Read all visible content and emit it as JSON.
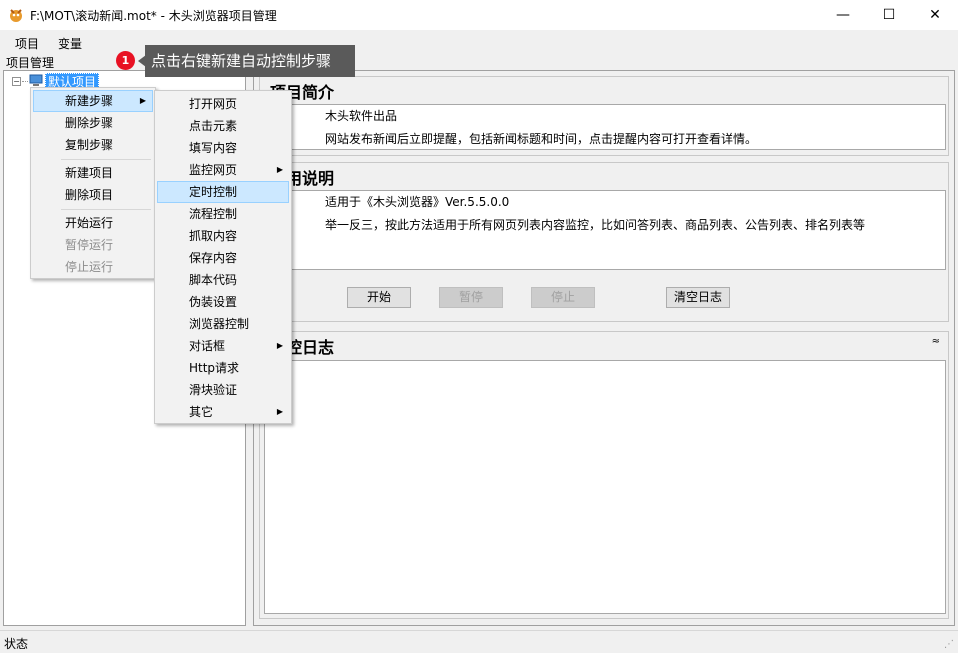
{
  "window": {
    "title": "F:\\MOT\\滚动新闻.mot* - 木头浏览器项目管理",
    "minimize": "—",
    "maximize": "☐",
    "close": "✕"
  },
  "menubar": {
    "items": [
      "项目",
      "变量"
    ]
  },
  "tree": {
    "label": "项目管理",
    "toggle": "−",
    "root_node": "默认项目"
  },
  "context_menu": {
    "items": [
      {
        "label": "新建步骤",
        "submenu": true,
        "highlighted": true
      },
      {
        "label": "删除步骤"
      },
      {
        "label": "复制步骤"
      },
      {
        "label": "新建项目"
      },
      {
        "label": "删除项目"
      },
      {
        "label": "开始运行"
      },
      {
        "label": "暂停运行",
        "disabled": true
      },
      {
        "label": "停止运行",
        "disabled": true
      }
    ]
  },
  "submenu": {
    "items": [
      {
        "label": "打开网页"
      },
      {
        "label": "点击元素"
      },
      {
        "label": "填写内容"
      },
      {
        "label": "监控网页",
        "submenu": true
      },
      {
        "label": "定时控制",
        "highlighted": true
      },
      {
        "label": "流程控制"
      },
      {
        "label": "抓取内容"
      },
      {
        "label": "保存内容"
      },
      {
        "label": "脚本代码"
      },
      {
        "label": "伪装设置"
      },
      {
        "label": "浏览器控制"
      },
      {
        "label": "对话框",
        "submenu": true
      },
      {
        "label": "Http请求"
      },
      {
        "label": "滑块验证"
      },
      {
        "label": "其它",
        "submenu": true
      }
    ],
    "arrow": "▶"
  },
  "tooltip": {
    "badge": "1",
    "text": "点击右键新建自动控制步骤"
  },
  "intro": {
    "title": "项目简介",
    "lines": [
      "木头软件出品",
      "网站发布新闻后立即提醒，包括新闻标题和时间，点击提醒内容可打开查看详情。"
    ]
  },
  "usage": {
    "title": "使用说明",
    "lines": [
      "适用于《木头浏览器》Ver.5.5.0.0",
      "举一反三，按此方法适用于所有网页列表内容监控，比如问答列表、商品列表、公告列表、排名列表等"
    ]
  },
  "buttons": {
    "start": "开始",
    "pause": "暂停",
    "stop": "停止",
    "clear_log": "清空日志"
  },
  "log": {
    "title": "监控日志",
    "collapse": "≈"
  },
  "status": {
    "text": "状态",
    "grip": "⋰"
  },
  "colors": {
    "selection": "#3399ff",
    "badge": "#e81123",
    "tooltip_bg": "#5a5a5a",
    "menu_highlight": "#cce8ff"
  }
}
